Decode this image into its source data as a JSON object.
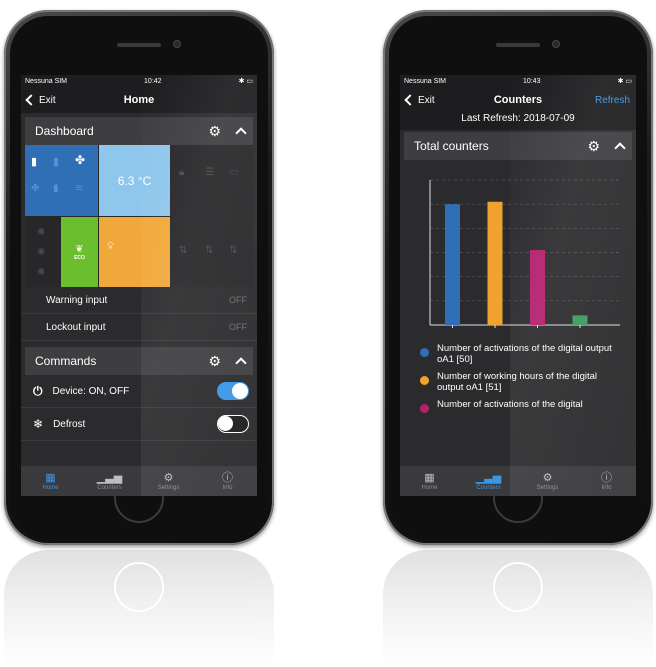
{
  "left_phone": {
    "status": {
      "carrier": "Nessuna SIM",
      "time": "10:42"
    },
    "nav": {
      "back_label": "Exit",
      "title": "Home"
    },
    "dashboard": {
      "title": "Dashboard",
      "temperature": "6.3 °C",
      "eco_label": "ECO",
      "rows": [
        {
          "label": "Warning input",
          "value": "OFF"
        },
        {
          "label": "Lockout input",
          "value": "OFF"
        }
      ]
    },
    "commands": {
      "title": "Commands",
      "items": [
        {
          "label": "Device: ON, OFF",
          "icon": "power-icon",
          "state": "on"
        },
        {
          "label": "Defrost",
          "icon": "snowflake-icon",
          "state": "off"
        }
      ]
    },
    "tabs": [
      {
        "label": "Home",
        "icon": "grid-icon",
        "active": true
      },
      {
        "label": "Counters",
        "icon": "bar-chart-icon",
        "active": false
      },
      {
        "label": "Settings",
        "icon": "gear-icon",
        "active": false
      },
      {
        "label": "Info",
        "icon": "info-icon",
        "active": false
      }
    ]
  },
  "right_phone": {
    "status": {
      "carrier": "Nessuna SIM",
      "time": "10:43"
    },
    "nav": {
      "back_label": "Exit",
      "title": "Counters",
      "action_label": "Refresh"
    },
    "last_refresh": "Last Refresh: 2018-07-09",
    "section_title": "Total counters",
    "legend": [
      {
        "text": "Number of activations of the digital output oA1 [50]",
        "color": "#2f6fb6"
      },
      {
        "text": "Number of working hours of the digital output oA1 [51]",
        "color": "#f0a12e"
      },
      {
        "text": "Number of activations of the digital",
        "color": "#b3206d"
      }
    ],
    "tabs": [
      {
        "label": "Home",
        "icon": "grid-icon",
        "active": false
      },
      {
        "label": "Counters",
        "icon": "bar-chart-icon",
        "active": true
      },
      {
        "label": "Settings",
        "icon": "gear-icon",
        "active": false
      },
      {
        "label": "Info",
        "icon": "info-icon",
        "active": false
      }
    ]
  },
  "chart_data": {
    "type": "bar",
    "categories": [
      "",
      "",
      "",
      ""
    ],
    "values": [
      50,
      51,
      31,
      4
    ],
    "colors": [
      "#2f6fb6",
      "#f0a12e",
      "#b3206d",
      "#3c9a5f"
    ],
    "ylim": [
      0,
      60
    ],
    "grid": true,
    "title": "",
    "xlabel": "",
    "ylabel": ""
  },
  "colors": {
    "accent": "#3a97e6",
    "screen_bg": "#2b2a2c",
    "header_bg": "#3e3d40",
    "tile_blue": "#2f6fb6",
    "tile_light_blue": "#8fc6ec",
    "tile_green": "#6bbf2f",
    "tile_orange": "#f0a83a"
  }
}
